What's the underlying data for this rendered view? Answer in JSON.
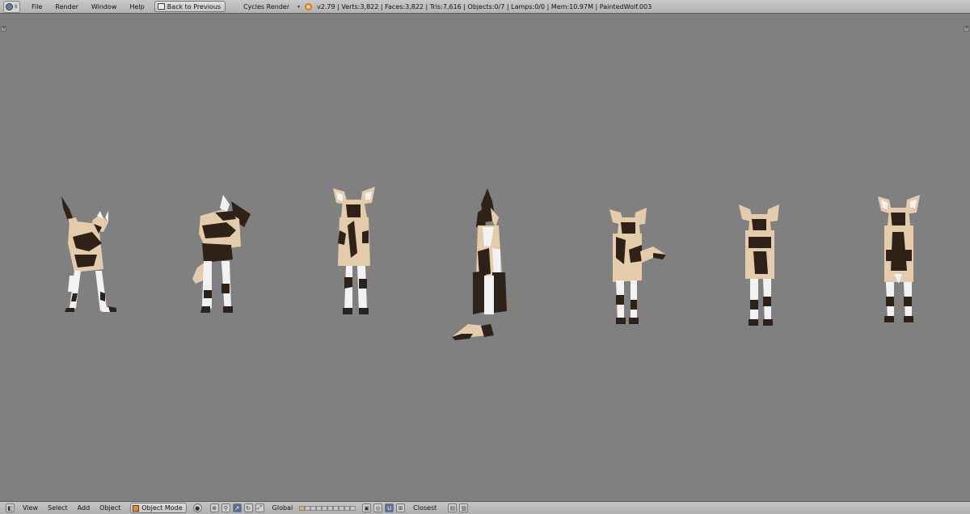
{
  "topbar": {
    "editor_icon": "info-icon",
    "menu": [
      "File",
      "Render",
      "Window",
      "Help"
    ],
    "back_button": "Back to Previous",
    "render_engine": "Cycles Render",
    "stats": "v2.79 | Verts:3,822 | Faces:3,822 | Tris:7,616 | Objects:0/7 | Lamps:0/0 | Mem:10.97M | PaintedWolf.003"
  },
  "viewport": {
    "background": "#808080",
    "objects": [
      "painted-wolf-1",
      "painted-wolf-2",
      "painted-wolf-3",
      "painted-wolf-4",
      "painted-wolf-5",
      "painted-wolf-6",
      "painted-wolf-7"
    ],
    "colors": {
      "fur_tan": "#e4ccaa",
      "fur_dark": "#2e2118",
      "fur_white": "#f2f2f4"
    }
  },
  "bottombar": {
    "menu": [
      "View",
      "Select",
      "Add",
      "Object"
    ],
    "mode": "Object Mode",
    "orientation": "Global",
    "snap_target": "Closest"
  }
}
